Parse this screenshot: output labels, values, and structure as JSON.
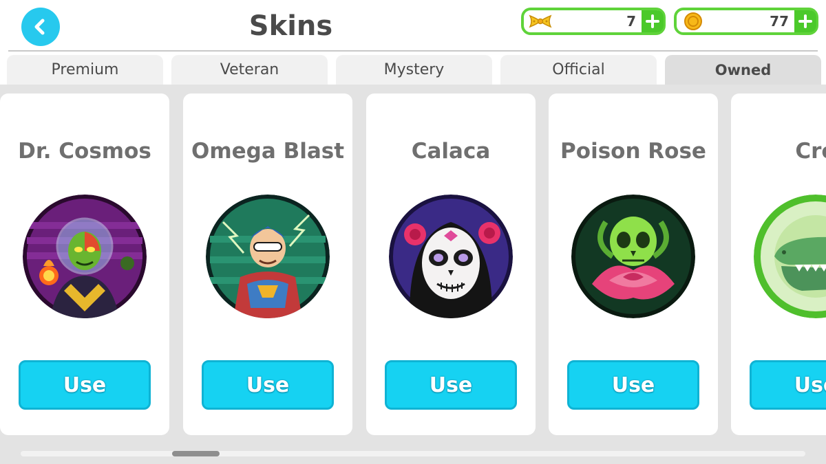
{
  "header": {
    "title": "Skins",
    "back_icon": "chevron-left-icon",
    "currencies": [
      {
        "icon": "ribbon-icon",
        "value": "7"
      },
      {
        "icon": "coin-icon",
        "value": "77"
      }
    ]
  },
  "tabs": [
    {
      "label": "Premium",
      "active": false
    },
    {
      "label": "Veteran",
      "active": false
    },
    {
      "label": "Mystery",
      "active": false
    },
    {
      "label": "Official",
      "active": false
    },
    {
      "label": "Owned",
      "active": true
    }
  ],
  "skins": [
    {
      "name": "Dr. Cosmos",
      "button": "Use",
      "portrait": "dr-cosmos-portrait"
    },
    {
      "name": "Omega Blast",
      "button": "Use",
      "portrait": "omega-blast-portrait"
    },
    {
      "name": "Calaca",
      "button": "Use",
      "portrait": "calaca-portrait"
    },
    {
      "name": "Poison Rose",
      "button": "Use",
      "portrait": "poison-rose-portrait"
    },
    {
      "name": "Cro",
      "button": "Use",
      "portrait": "crocodile-portrait"
    }
  ],
  "colors": {
    "accent": "#16d2f2",
    "currency_border": "#5fd33a",
    "panel_background": "#e3e3e3"
  }
}
